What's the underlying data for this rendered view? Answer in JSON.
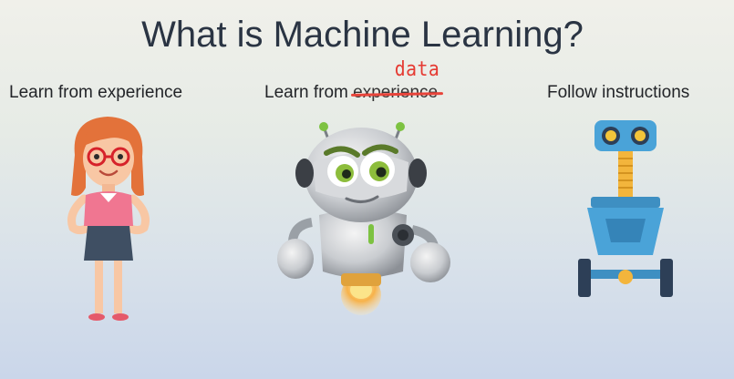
{
  "slide": {
    "title": "What is Machine Learning?",
    "columns": [
      {
        "label": "Learn from experience",
        "figure_icon": "girl-icon"
      },
      {
        "label_prefix": "Learn from ",
        "struck_word": "experience",
        "annotation": "data",
        "figure_icon": "robot-icon",
        "strike_color": "#e8443a"
      },
      {
        "label": "Follow instructions",
        "figure_icon": "simple-robot-icon"
      }
    ]
  }
}
